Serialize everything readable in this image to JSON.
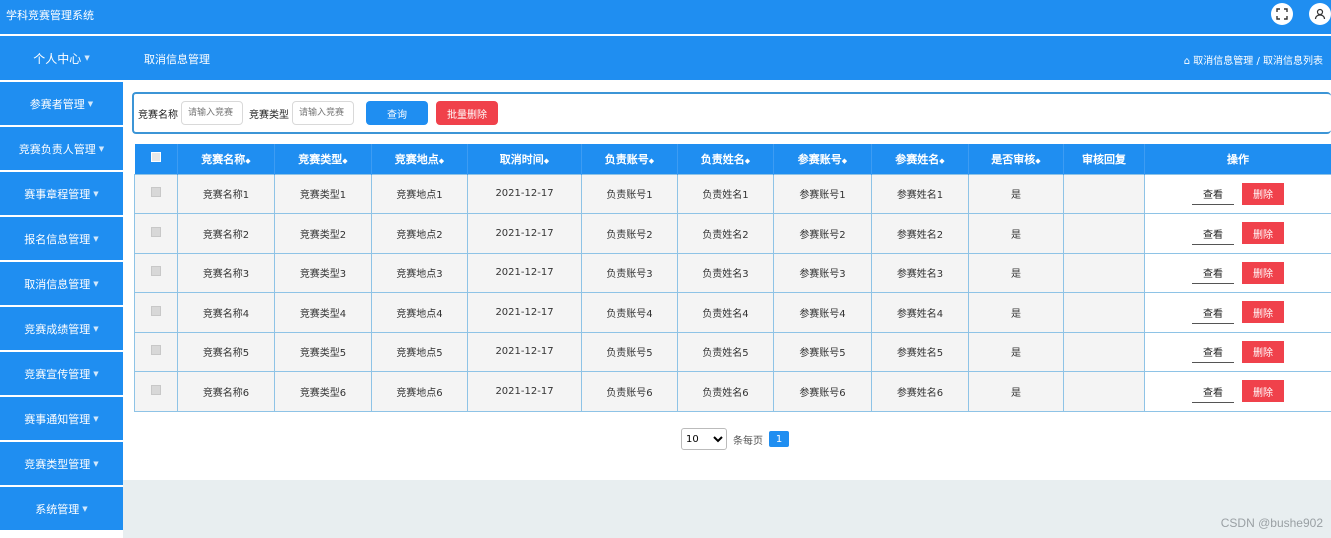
{
  "app": {
    "title": "学科竞赛管理系统"
  },
  "topbar_icons": [
    "fullscreen-icon",
    "user-icon"
  ],
  "subbar": {
    "user_center": "个人中心",
    "page_title": "取消信息管理",
    "breadcrumb": "取消信息管理 / 取消信息列表"
  },
  "sidebar": {
    "items": [
      {
        "label": "参赛者管理"
      },
      {
        "label": "竞赛负责人管理"
      },
      {
        "label": "赛事章程管理"
      },
      {
        "label": "报名信息管理"
      },
      {
        "label": "取消信息管理"
      },
      {
        "label": "竞赛成绩管理"
      },
      {
        "label": "竞赛宣传管理"
      },
      {
        "label": "赛事通知管理"
      },
      {
        "label": "竞赛类型管理"
      },
      {
        "label": "系统管理"
      }
    ]
  },
  "search": {
    "name_label": "竞赛名称",
    "name_placeholder": "请输入竞赛",
    "type_label": "竞赛类型",
    "type_placeholder": "请输入竞赛",
    "query_button": "查询",
    "batch_delete_button": "批量删除"
  },
  "table": {
    "headers": [
      "竞赛名称",
      "竞赛类型",
      "竞赛地点",
      "取消时间",
      "负责账号",
      "负责姓名",
      "参赛账号",
      "参赛姓名",
      "是否审核",
      "审核回复",
      "操作"
    ],
    "rows": [
      {
        "name": "竞赛名称1",
        "type": "竞赛类型1",
        "location": "竞赛地点1",
        "cancel_time": "2021-12-17",
        "owner_account": "负责账号1",
        "owner_name": "负责姓名1",
        "player_account": "参赛账号1",
        "player_name": "参赛姓名1",
        "reviewed": "是",
        "reply": ""
      },
      {
        "name": "竞赛名称2",
        "type": "竞赛类型2",
        "location": "竞赛地点2",
        "cancel_time": "2021-12-17",
        "owner_account": "负责账号2",
        "owner_name": "负责姓名2",
        "player_account": "参赛账号2",
        "player_name": "参赛姓名2",
        "reviewed": "是",
        "reply": ""
      },
      {
        "name": "竞赛名称3",
        "type": "竞赛类型3",
        "location": "竞赛地点3",
        "cancel_time": "2021-12-17",
        "owner_account": "负责账号3",
        "owner_name": "负责姓名3",
        "player_account": "参赛账号3",
        "player_name": "参赛姓名3",
        "reviewed": "是",
        "reply": ""
      },
      {
        "name": "竞赛名称4",
        "type": "竞赛类型4",
        "location": "竞赛地点4",
        "cancel_time": "2021-12-17",
        "owner_account": "负责账号4",
        "owner_name": "负责姓名4",
        "player_account": "参赛账号4",
        "player_name": "参赛姓名4",
        "reviewed": "是",
        "reply": ""
      },
      {
        "name": "竞赛名称5",
        "type": "竞赛类型5",
        "location": "竞赛地点5",
        "cancel_time": "2021-12-17",
        "owner_account": "负责账号5",
        "owner_name": "负责姓名5",
        "player_account": "参赛账号5",
        "player_name": "参赛姓名5",
        "reviewed": "是",
        "reply": ""
      },
      {
        "name": "竞赛名称6",
        "type": "竞赛类型6",
        "location": "竞赛地点6",
        "cancel_time": "2021-12-17",
        "owner_account": "负责账号6",
        "owner_name": "负责姓名6",
        "player_account": "参赛账号6",
        "player_name": "参赛姓名6",
        "reviewed": "是",
        "reply": ""
      }
    ],
    "view_button": "查看",
    "delete_button": "删除"
  },
  "pagination": {
    "page_size": "10",
    "page_size_options": [
      "10"
    ],
    "per_page_label": "条每页",
    "current_page": "1"
  },
  "watermark": "CSDN @bushe902",
  "colors": {
    "primary": "#1f8ef1",
    "danger": "#f0414b",
    "border": "#8ec3e6"
  }
}
